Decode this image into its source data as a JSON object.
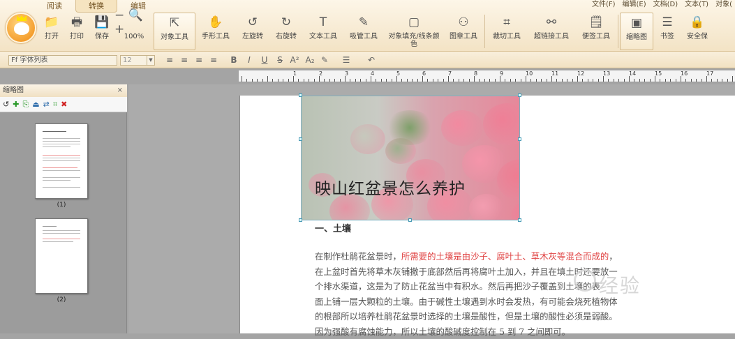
{
  "tabs": [
    "阅读",
    "转换",
    "编辑"
  ],
  "menus": [
    "文件(F)",
    "编辑(E)",
    "文档(D)",
    "文本(T)",
    "对象("
  ],
  "toolbar": [
    {
      "icon": "folder-icon",
      "label": "打开",
      "sym": "📁"
    },
    {
      "icon": "printer-icon",
      "label": "打印",
      "sym": "🖶"
    },
    {
      "icon": "save-icon",
      "label": "保存",
      "sym": "💾"
    },
    {
      "icon": "zoom-icon",
      "label": "100%",
      "sym": "− 🔍 +"
    },
    {
      "icon": "cursor-icon",
      "label": "对象工具",
      "sym": "⇱"
    },
    {
      "icon": "hand-icon",
      "label": "手形工具",
      "sym": "✋"
    },
    {
      "icon": "rotate-left-icon",
      "label": "左旋转",
      "sym": "↺"
    },
    {
      "icon": "rotate-right-icon",
      "label": "右旋转",
      "sym": "↻"
    },
    {
      "icon": "text-icon",
      "label": "文本工具",
      "sym": "T"
    },
    {
      "icon": "eyedropper-icon",
      "label": "吸管工具",
      "sym": "✎"
    },
    {
      "icon": "fill-icon",
      "label": "对象填充/线条颜色",
      "sym": "▢"
    },
    {
      "icon": "stamp-icon",
      "label": "图章工具",
      "sym": "⚇"
    },
    {
      "icon": "crop-icon",
      "label": "裁切工具",
      "sym": "⌗"
    },
    {
      "icon": "link-icon",
      "label": "超链接工具",
      "sym": "⚯"
    },
    {
      "icon": "note-icon",
      "label": "便签工具",
      "sym": "🗒"
    },
    {
      "icon": "thumbnail-icon",
      "label": "缩略图",
      "sym": "▣"
    },
    {
      "icon": "bookmark-icon",
      "label": "书签",
      "sym": "☰"
    },
    {
      "icon": "lock-icon",
      "label": "安全保",
      "sym": "🔒"
    }
  ],
  "format": {
    "font_placeholder": "字体列表",
    "font_prefix": "Ff",
    "size": "12"
  },
  "panel": {
    "title": "缩略图",
    "close": "⨯",
    "thumbs": [
      "(1)",
      "(2)"
    ]
  },
  "doc": {
    "title": "映山红盆景怎么养护",
    "heading": "一、土壤",
    "lines": [
      {
        "a": "在制作杜鹃花盆景时，",
        "r": "所需要的土壤是由沙子、腐叶土、草木灰等混合而成的",
        "b": "，"
      },
      {
        "a": "在上盆时首先将草木灰铺撒于底部然后再将腐叶土加入，并且在填土时还要放一",
        "r": "",
        "b": ""
      },
      {
        "a": "个排水渠道，这是为了防止花盆当中有积水。然后再把沙子覆盖到土壤的表",
        "r": "",
        "b": ""
      },
      {
        "a": "面上铺一层大颗粒的土壤。由于碱性土壤遇到水时会发热，有可能会烧死植物体",
        "r": "",
        "b": ""
      },
      {
        "a": "的根部所以培养杜鹃花盆景时选择的土壤是酸性，但是土壤的酸性必须是弱酸。",
        "r": "",
        "b": ""
      },
      {
        "a": "因为强酸有腐蚀能力，所以土壤的酸碱度控制在 5 到 7 之间即可。",
        "r": "",
        "b": ""
      }
    ]
  },
  "ruler": [
    "1",
    "2",
    "3",
    "4",
    "5",
    "6",
    "7",
    "8",
    "9",
    "10",
    "11",
    "12",
    "13",
    "14",
    "15",
    "16",
    "17"
  ],
  "watermark": "经验"
}
